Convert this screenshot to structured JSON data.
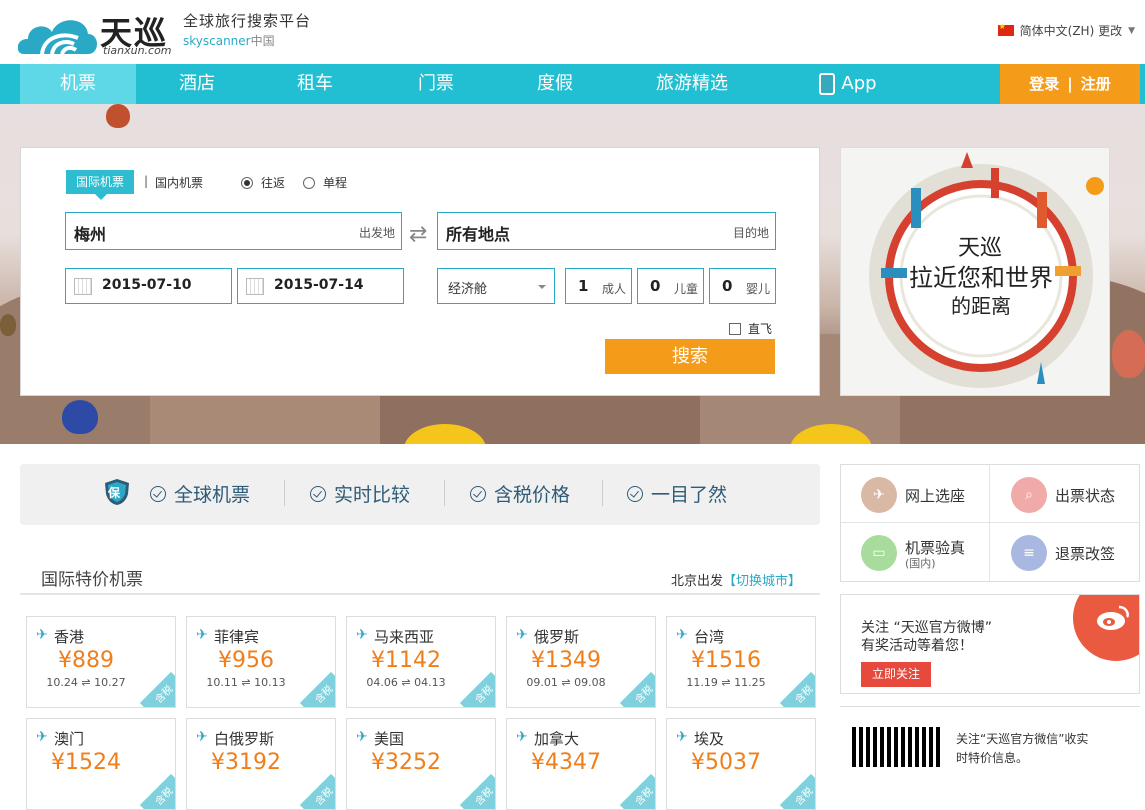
{
  "header": {
    "brand_cn": "天巡",
    "brand_en": "tianxun.com",
    "tagline": "全球旅行搜索平台",
    "sub_tag_brand": "skyscanner",
    "sub_tag_region": "中国",
    "language": "简体中文(ZH) 更改"
  },
  "nav": {
    "items": [
      "机票",
      "酒店",
      "租车",
      "门票",
      "度假",
      "旅游精选",
      "App"
    ],
    "login": "登录",
    "sep": "|",
    "register": "注册"
  },
  "search": {
    "tab_intl": "国际机票",
    "tab_sep": "|",
    "tab_dom": "国内机票",
    "trip_round": "往返",
    "trip_oneway": "单程",
    "origin_value": "梅州",
    "origin_label": "出发地",
    "dest_value": "所有地点",
    "dest_label": "目的地",
    "swap": "⇄",
    "depart_date": "2015-07-10",
    "return_date": "2015-07-14",
    "cabin": "经济舱",
    "adults": "1",
    "adults_label": "成人",
    "children": "0",
    "children_label": "儿童",
    "infants": "0",
    "infants_label": "婴儿",
    "direct": "直飞",
    "button": "搜索"
  },
  "promo": {
    "line1": "天巡",
    "line2": "拉近您和世界",
    "line3": "的距离"
  },
  "features": {
    "shield_text": "保",
    "items": [
      "全球机票",
      "实时比较",
      "含税价格",
      "一目了然"
    ]
  },
  "deals": {
    "title": "国际特价机票",
    "depart_from": "北京出发",
    "switch_city": "【切换城市】",
    "tax_label": "含税",
    "cards": [
      {
        "city": "香港",
        "price": "¥889",
        "dates": "10.24 ⇌ 10.27"
      },
      {
        "city": "菲律宾",
        "price": "¥956",
        "dates": "10.11 ⇌ 10.13"
      },
      {
        "city": "马来西亚",
        "price": "¥1142",
        "dates": "04.06 ⇌ 04.13"
      },
      {
        "city": "俄罗斯",
        "price": "¥1349",
        "dates": "09.01 ⇌ 09.08"
      },
      {
        "city": "台湾",
        "price": "¥1516",
        "dates": "11.19 ⇌ 11.25"
      },
      {
        "city": "澳门",
        "price": "¥1524",
        "dates": ""
      },
      {
        "city": "白俄罗斯",
        "price": "¥3192",
        "dates": ""
      },
      {
        "city": "美国",
        "price": "¥3252",
        "dates": ""
      },
      {
        "city": "加拿大",
        "price": "¥4347",
        "dates": ""
      },
      {
        "city": "埃及",
        "price": "¥5037",
        "dates": ""
      }
    ]
  },
  "services": {
    "seat": "网上选座",
    "ticket_status": "出票状态",
    "verify": "机票验真",
    "verify_sub": "(国内)",
    "refund": "退票改签"
  },
  "weibo": {
    "follow_text": "关注 “天巡官方微博”",
    "activity": "有奖活动等着您！",
    "follow_button": "立即关注"
  },
  "wechat": {
    "line1": "关注“天巡官方微信”收实",
    "line2": "时特价信息。"
  },
  "colors": {
    "nav_teal": "#22bfd2",
    "accent_orange": "#f59b1a",
    "price_orange": "#f07e1a",
    "weibo_red": "#e64a3c"
  }
}
